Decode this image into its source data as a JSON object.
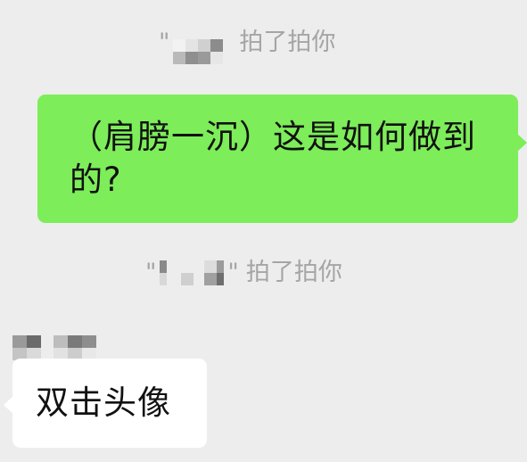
{
  "notices": [
    {
      "open_quote": "\"",
      "close_quote": "",
      "text": "拍了拍你"
    },
    {
      "open_quote": "\"",
      "close_quote": "\"",
      "text": "拍了拍你"
    }
  ],
  "messages": {
    "outgoing": {
      "text": "（肩膀一沉）这是如何做到的?"
    },
    "incoming": {
      "text": "双击头像"
    }
  },
  "colors": {
    "background": "#ededed",
    "outgoing_bubble": "#7ded5a",
    "incoming_bubble": "#ffffff",
    "notice_text": "#a5a5a5",
    "message_text": "#111111"
  }
}
